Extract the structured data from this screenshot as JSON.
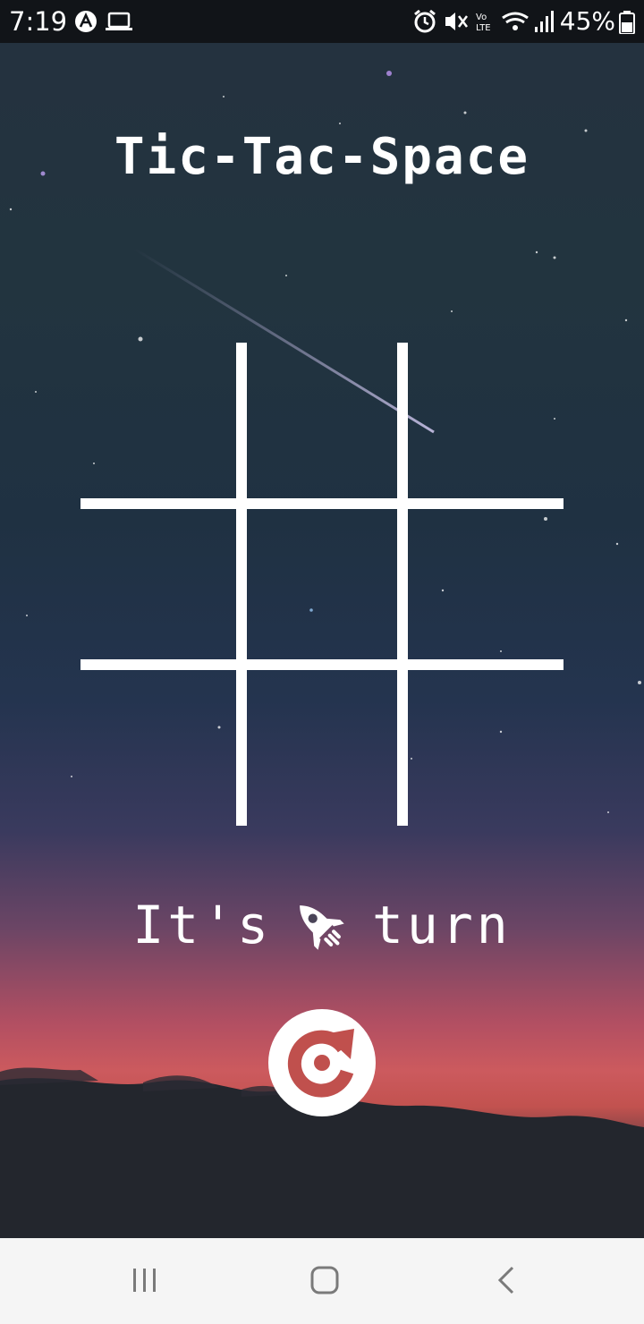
{
  "status_bar": {
    "time": "7:19",
    "battery": "45%",
    "icons": [
      "a-circle-icon",
      "laptop-icon",
      "alarm-icon",
      "mute-icon",
      "volte-icon",
      "wifi-icon",
      "signal-icon",
      "battery-icon"
    ]
  },
  "app": {
    "title": "Tic-Tac-Space"
  },
  "board": {
    "rows": 3,
    "cols": 3,
    "cells": [
      "",
      "",
      "",
      "",
      "",
      "",
      "",
      "",
      ""
    ],
    "line_color": "#ffffff"
  },
  "turn": {
    "prefix": "It's",
    "player_icon": "rocket-icon",
    "suffix": "turn"
  },
  "restart": {
    "icon": "restart-icon",
    "icon_color": "#c0504d"
  },
  "nav_bar": {
    "buttons": [
      "recent-apps-icon",
      "home-icon",
      "back-icon"
    ]
  }
}
